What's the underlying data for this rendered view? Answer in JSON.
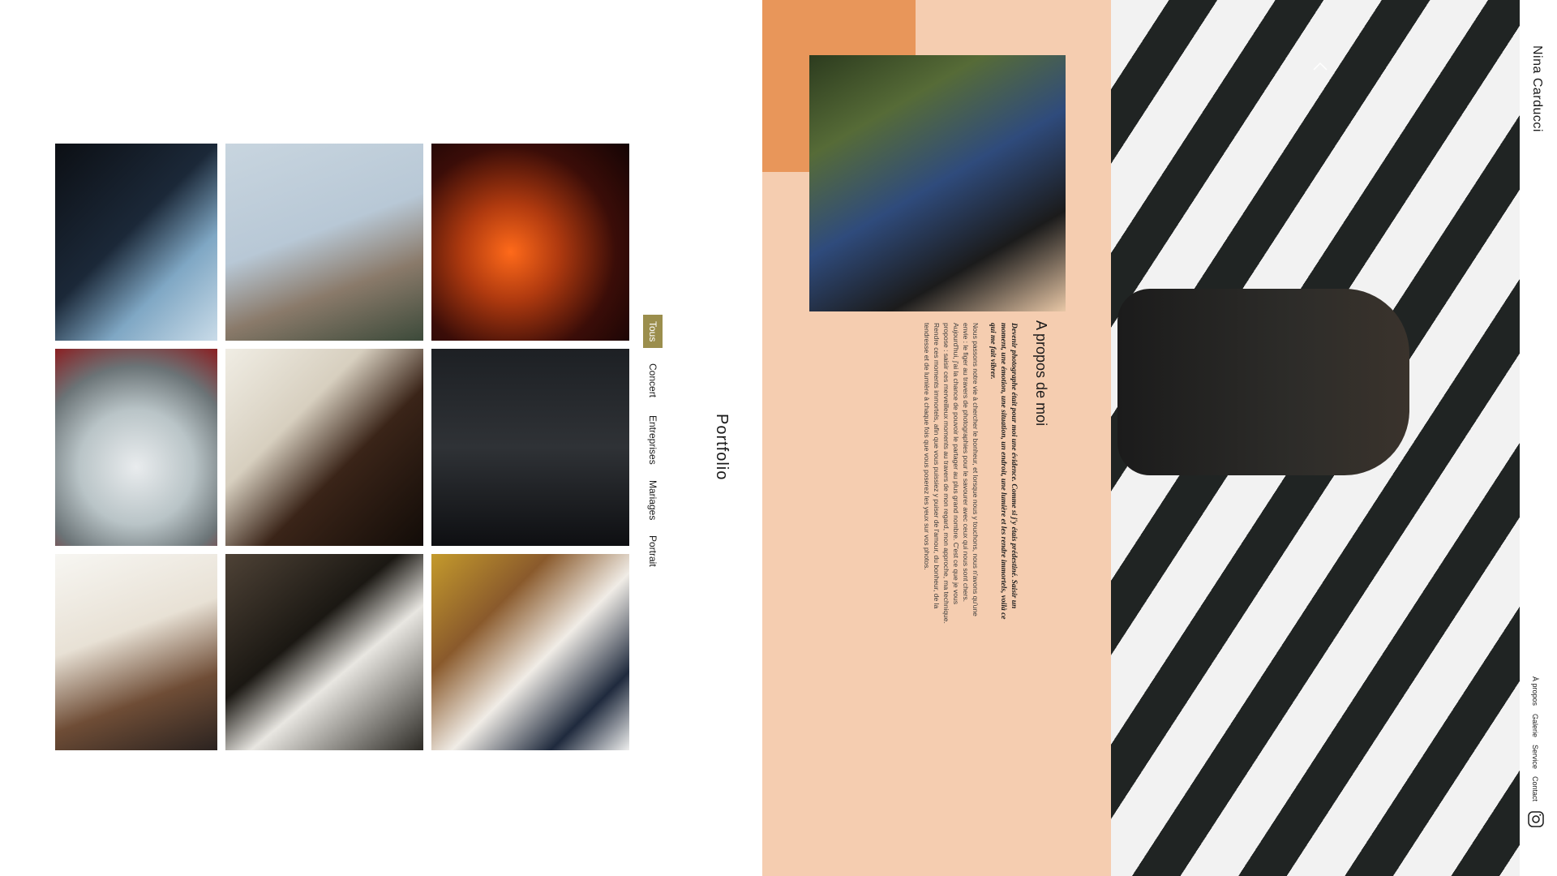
{
  "site": {
    "name": "Nina Carducci"
  },
  "nav": {
    "items": [
      "À propos",
      "Galerie",
      "Service",
      "Contact"
    ],
    "instagram_icon": "instagram-icon"
  },
  "hero": {
    "slider_arrow_icon": "chevron-left-icon"
  },
  "about": {
    "title": "A propos de moi",
    "lead": "Devenir photographe était pour moi une évidence. Comme si j'y étais prédestiné. Saisir un moment, une émotion, une situation, un endroit, une lumière et les rendre immortels, voilà ce qui me fait vibrer.",
    "body": "Nous passons notre vie à chercher le bonheur, et lorsque nous y touchons, nous n'avons qu'une envie : le figer au travers de photographies pour le savourer avec ceux qui nous sont chers. Aujourd'hui, j'ai la chance de pouvoir le partager au plus grand nombre. C'est ce que je vous propose : saisir ces merveilleux moments au travers de mon regard, mon approche, ma technique. Rendre ces moments immortels, afin que vous puissiez y puiser de l'amour, du bonheur, de la tendresse et de lumière à chaque fois que vous poserez les yeux sur vos photos."
  },
  "portfolio": {
    "title": "Portfolio",
    "filters": [
      "Tous",
      "Concert",
      "Entreprises",
      "Mariages",
      "Portrait"
    ],
    "active_filter": "Tous"
  },
  "colors": {
    "accent_olive": "#9b8e4d",
    "about_bg": "#f5cdb0",
    "about_block": "#e8965a"
  }
}
